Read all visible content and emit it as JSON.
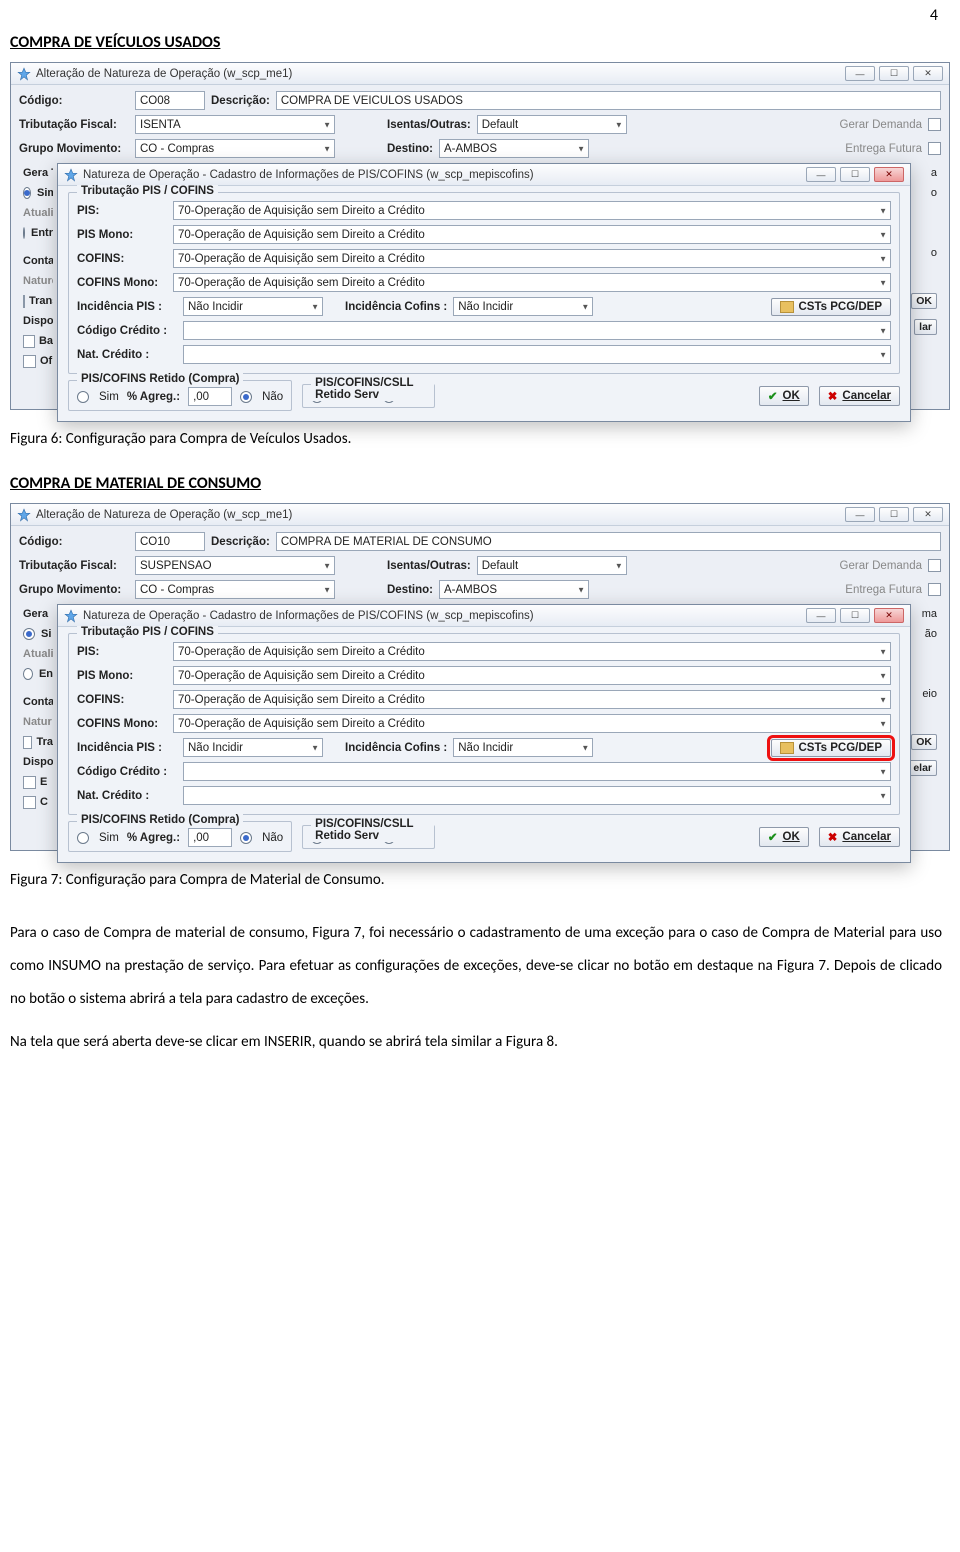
{
  "page_number": "4",
  "headings": {
    "h1": "COMPRA DE VEÍCULOS USADOS",
    "h2": "COMPRA DE MATERIAL DE CONSUMO"
  },
  "captions": {
    "fig6": "Figura 6: Configuração para Compra de Veículos Usados.",
    "fig7": "Figura 7: Configuração para Compra de Material de Consumo."
  },
  "paragraphs": {
    "p1": "Para o caso de Compra de material de consumo, Figura 7, foi necessário o cadastramento de uma exceção para o caso de Compra de Material para uso como INSUMO na prestação de serviço. Para efetuar as configurações de exceções, deve-se clicar no botão em destaque na Figura 7. Depois de clicado no botão o sistema abrirá a tela para cadastro de exceções.",
    "p2": "Na tela que será aberta deve-se clicar em INSERIR, quando se abrirá tela similar a Figura 8."
  },
  "win": {
    "title_parent": "Alteração de Natureza de Operação (w_scp_me1)",
    "title_modal": "Natureza de Operação - Cadastro de Informações de PIS/COFINS (w_scp_mepiscofins)",
    "labels": {
      "codigo": "Código:",
      "descricao": "Descrição:",
      "tribfiscal": "Tributação Fiscal:",
      "isentas": "Isentas/Outras:",
      "grupo": "Grupo Movimento:",
      "destino": "Destino:",
      "gerardemanda": "Gerar Demanda",
      "entregafutura": "Entrega Futura",
      "tribpiscofins": "Tributação PIS / COFINS",
      "pis": "PIS:",
      "pismono": "PIS Mono:",
      "cofins": "COFINS:",
      "cofinsmono": "COFINS Mono:",
      "incpis": "Incidência PIS :",
      "inccofins": "Incidência Cofins :",
      "codcredito": "Código Crédito :",
      "natcredito": "Nat. Crédito :",
      "retido_compra": "PIS/COFINS Retido (Compra)",
      "retido_serv": "PIS/COFINS/CSLL Retido Serv",
      "sim": "Sim",
      "nao": "Não",
      "agreg": "% Agreg.:",
      "csts": "CSTs PCG/DEP",
      "ok": "OK",
      "cancelar": "Cancelar"
    },
    "opt70": "70-Operação de Aquisição sem Direito a Crédito",
    "naoincidir": "Não Incidir",
    "agregval": ",00",
    "default": "Default",
    "ambos": "A-AMBOS",
    "cocompras": "CO - Compras"
  },
  "fig6": {
    "codigo": "CO08",
    "descricao": "COMPRA DE VEICULOS USADOS",
    "trib": "ISENTA"
  },
  "fig7": {
    "codigo": "CO10",
    "descricao": "COMPRA DE MATERIAL DE CONSUMO",
    "trib": "SUSPENSAO"
  },
  "cutoffs": {
    "left": [
      "Gera T",
      "Sim",
      "Atualiz",
      "Entr",
      "Conta G",
      "Nature",
      "Trans",
      "Dispon",
      "Ba",
      "Of"
    ],
    "left2": [
      "Gera",
      "Si",
      "Atuali",
      "En",
      "Conta",
      "Natur",
      "Tra",
      "Dispo",
      "E",
      "C"
    ],
    "right": [
      "a",
      "o",
      "o",
      "OK",
      "lar"
    ],
    "right2": [
      "ma",
      "ão",
      "eio",
      "OK",
      "elar"
    ]
  }
}
